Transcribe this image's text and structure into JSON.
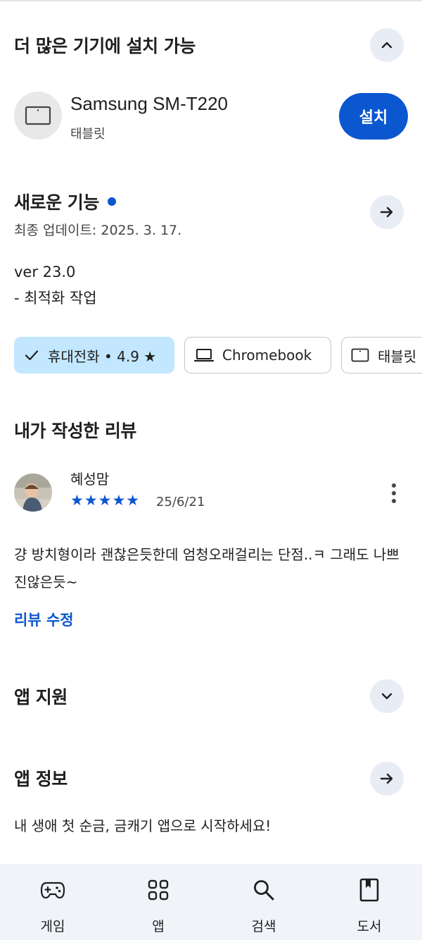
{
  "more_devices": {
    "title": "더 많은 기기에 설치 가능",
    "toggle_icon": "chevron-up-icon",
    "device": {
      "name": "Samsung SM-T220",
      "type": "태블릿",
      "icon": "tablet-icon",
      "install_label": "설치"
    }
  },
  "whats_new": {
    "title": "새로운 기능",
    "updated": "최종 업데이트: 2025. 3. 17.",
    "version": "ver 23.0",
    "note": "- 최적화 작업",
    "arrow_icon": "arrow-right-icon"
  },
  "device_chips": [
    {
      "label": "휴대전화 • 4.9 ★",
      "icon": "check-icon",
      "selected": true
    },
    {
      "label": "Chromebook",
      "icon": "laptop-icon",
      "selected": false
    },
    {
      "label": "태블릿",
      "icon": "tablet-icon",
      "selected": false
    }
  ],
  "my_review": {
    "title": "내가 작성한 리뷰",
    "reviewer": "혜성맘",
    "stars": "★★★★★",
    "rating": 5,
    "date": "25/6/21",
    "text": "걍 방치형이라 괜찮은듯한데 엄청오래걸리는 단점..ㅋ 그래도 나쁘진않은듯~",
    "edit_label": "리뷰 수정"
  },
  "app_support": {
    "title": "앱 지원",
    "toggle_icon": "chevron-down-icon"
  },
  "app_info": {
    "title": "앱 정보",
    "description": "내 생애 첫 순금, 금캐기 앱으로 시작하세요!",
    "arrow_icon": "arrow-right-icon"
  },
  "bottom_nav": [
    {
      "label": "게임",
      "icon": "gamepad-icon"
    },
    {
      "label": "앱",
      "icon": "apps-grid-icon"
    },
    {
      "label": "검색",
      "icon": "search-icon"
    },
    {
      "label": "도서",
      "icon": "book-icon"
    }
  ],
  "colors": {
    "accent": "#0b57d0",
    "chip_selected": "#c2e7ff",
    "circle_button": "#e8ecf5",
    "nav_background": "#f0f4f9"
  }
}
